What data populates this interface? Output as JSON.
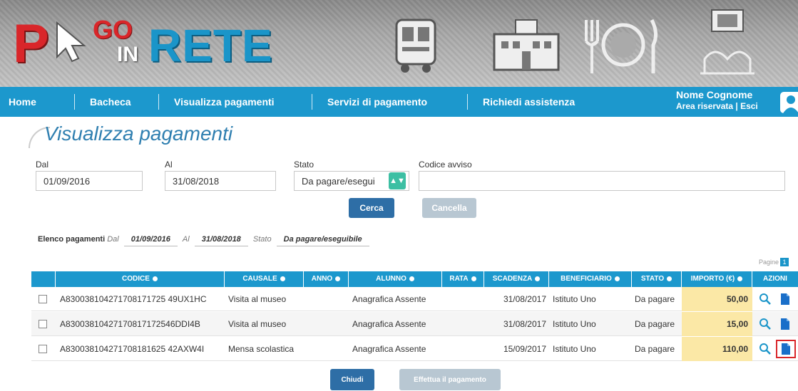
{
  "logo": {
    "p": "P",
    "go": "GO",
    "in": "IN",
    "rete": "RETE"
  },
  "nav": {
    "items": [
      "Home",
      "Bacheca",
      "Visualizza pagamenti",
      "Servizi di pagamento",
      "Richiedi assistenza"
    ],
    "user_name": "Nome Cognome",
    "user_links": "Area riservata | Esci"
  },
  "page": {
    "title": "Visualizza pagamenti"
  },
  "filters": {
    "dal_label": "Dal",
    "dal_value": "01/09/2016",
    "al_label": "Al",
    "al_value": "31/08/2018",
    "stato_label": "Stato",
    "stato_value": "Da pagare/esegui",
    "codice_label": "Codice avviso",
    "codice_value": "",
    "cerca": "Cerca",
    "cancella": "Cancella"
  },
  "summary": {
    "label": "Elenco pagamenti",
    "dal_k": "Dal",
    "dal_v": "01/09/2016",
    "al_k": "Al",
    "al_v": "31/08/2018",
    "stato_k": "Stato",
    "stato_v": "Da pagare/eseguibile"
  },
  "pager": {
    "label": "Pagine",
    "page": "1"
  },
  "table": {
    "headers": [
      "CODICE",
      "CAUSALE",
      "ANNO",
      "ALUNNO",
      "RATA",
      "SCADENZA",
      "BENEFICIARIO",
      "STATO",
      "IMPORTO (€)",
      "AZIONI"
    ],
    "rows": [
      {
        "codice": "A830038104271708171725 49UX1HC",
        "causale": "Visita al museo",
        "anno": "",
        "alunno": "Anagrafica Assente",
        "rata": "",
        "scadenza": "31/08/2017",
        "beneficiario": "Istituto Uno",
        "stato": "Da pagare",
        "importo": "50,00"
      },
      {
        "codice": "A83003810427170817172546DDI4B",
        "causale": "Visita al museo",
        "anno": "",
        "alunno": "Anagrafica Assente",
        "rata": "",
        "scadenza": "31/08/2017",
        "beneficiario": "Istituto Uno",
        "stato": "Da pagare",
        "importo": "15,00"
      },
      {
        "codice": "A830038104271708181625 42AXW4I",
        "causale": "Mensa scolastica",
        "anno": "",
        "alunno": "Anagrafica Assente",
        "rata": "",
        "scadenza": "15/09/2017",
        "beneficiario": "Istituto Uno",
        "stato": "Da pagare",
        "importo": "110,00"
      }
    ]
  },
  "actions": {
    "chiudi": "Chiudi",
    "effettua": "Effettua il pagamento"
  },
  "colors": {
    "nav": "#1c98cd",
    "primary": "#2e6ea6",
    "importo_bg": "#fbe8a6",
    "brand_red": "#d9262a",
    "brand_blue": "#1a95c9"
  }
}
